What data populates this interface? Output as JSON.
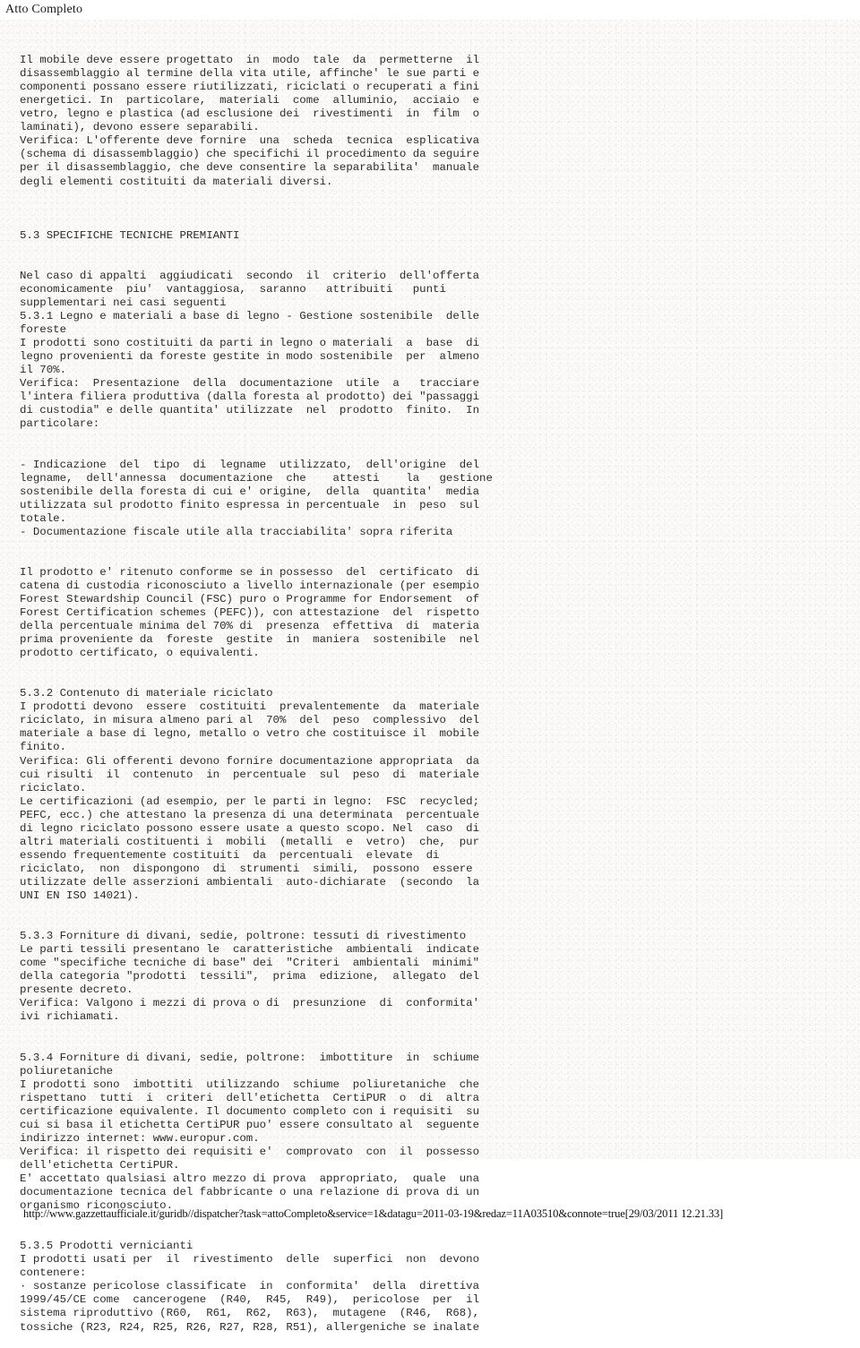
{
  "page": {
    "header_title": "Atto Completo",
    "background_color": "#fbfaf8",
    "text_color": "#2b2b2b"
  },
  "document": {
    "blocks": [
      {
        "id": "intro-disassemblaggio",
        "text": "Il mobile deve essere progettato  in  modo  tale  da  permetterne  il\ndisassemblaggio al termine della vita utile, affinche' le sue parti e\ncomponenti possano essere riutilizzati, riciclati o recuperati a fini\nenergetici. In  particolare,  materiali  come  alluminio,  acciaio  e\nvetro, legno e plastica (ad esclusione dei  rivestimenti  in  film  o\nlaminati), devono essere separabili.\nVerifica: L'offerente deve fornire  una  scheda  tecnica  esplicativa\n(schema di disassemblaggio) che specifichi il procedimento da seguire\nper il disassemblaggio, che deve consentire la separabilita'  manuale\ndegli elementi costituiti da materiali diversi."
      },
      {
        "id": "heading-5-3",
        "text": "\n5.3 SPECIFICHE TECNICHE PREMIANTI\n"
      },
      {
        "id": "premianti-intro",
        "text": "Nel caso di appalti  aggiudicati  secondo  il  criterio  dell'offerta\neconomicamente  piu'  vantaggiosa,  saranno   attribuiti   punti\nsupplementari nei casi seguenti\n5.3.1 Legno e materiali a base di legno - Gestione sostenibile  delle\nforeste\nI prodotti sono costituiti da parti in legno o materiali  a  base  di\nlegno provenienti da foreste gestite in modo sostenibile  per  almeno\nil 70%.\nVerifica:  Presentazione  della  documentazione  utile  a   tracciare\nl'intera filiera produttiva (dalla foresta al prodotto) dei \"passaggi\ndi custodia\" e delle quantita' utilizzate  nel  prodotto  finito.  In\nparticolare:\n"
      },
      {
        "id": "indicazioni-legname",
        "text": "- Indicazione  del  tipo  di  legname  utilizzato,  dell'origine  del\nlegname,  dell'annessa  documentazione  che    attesti    la   gestione\nsostenibile della foresta di cui e' origine,  della  quantita'  media\nutilizzata sul prodotto finito espressa in percentuale  in  peso  sul\ntotale.\n- Documentazione fiscale utile alla tracciabilita' sopra riferita\n"
      },
      {
        "id": "certificato-catena-custodia",
        "text": "Il prodotto e' ritenuto conforme se in possesso  del  certificato  di\ncatena di custodia riconosciuto a livello internazionale (per esempio\nForest Stewardship Council (FSC) puro o Programme for Endorsement  of\nForest Certification schemes (PEFC)), con attestazione  del  rispetto\ndella percentuale minima del 70% di  presenza  effettiva  di  materia\nprima proveniente da  foreste  gestite  in  maniera  sostenibile  nel\nprodotto certificato, o equivalenti.\n"
      },
      {
        "id": "sezione-5-3-2",
        "text": "5.3.2 Contenuto di materiale riciclato\nI prodotti devono  essere  costituiti  prevalentemente  da  materiale\nriciclato, in misura almeno pari al  70%  del  peso  complessivo  del\nmateriale a base di legno, metallo o vetro che costituisce il  mobile\nfinito.\nVerifica: Gli offerenti devono fornire documentazione appropriata  da\ncui risulti  il  contenuto  in  percentuale  sul  peso  di  materiale\nriciclato.\nLe certificazioni (ad esempio, per le parti in legno:  FSC  recycled;\nPEFC, ecc.) che attestano la presenza di una determinata  percentuale\ndi legno riciclato possono essere usate a questo scopo. Nel  caso  di\naltri materiali costituenti i  mobili  (metalli  e  vetro)  che,  pur\nessendo frequentemente costituiti  da  percentuali  elevate  di\nriciclato,  non  dispongono  di  strumenti  simili,  possono  essere\nutilizzate delle asserzioni ambientali  auto-dichiarate  (secondo  la\nUNI EN ISO 14021).\n"
      },
      {
        "id": "sezione-5-3-3",
        "text": "5.3.3 Forniture di divani, sedie, poltrone: tessuti di rivestimento\nLe parti tessili presentano le  caratteristiche  ambientali  indicate\ncome \"specifiche tecniche di base\" dei  \"Criteri  ambientali  minimi\"\ndella categoria \"prodotti  tessili\",  prima  edizione,  allegato  del\npresente decreto.\nVerifica: Valgono i mezzi di prova o di  presunzione  di  conformita'\nivi richiamati.\n"
      },
      {
        "id": "sezione-5-3-4",
        "text": "5.3.4 Forniture di divani, sedie, poltrone:  imbottiture  in  schiume\npoliuretaniche\nI prodotti sono  imbottiti  utilizzando  schiume  poliuretaniche  che\nrispettano  tutti  i  criteri  dell'etichetta  CertiPUR  o  di  altra\ncertificazione equivalente. Il documento completo con i requisiti  su\ncui si basa il etichetta CertiPUR puo' essere consultato al  seguente\nindirizzo internet: www.europur.com.\nVerifica: il rispetto dei requisiti e'  comprovato  con  il  possesso\ndell'etichetta CertiPUR.\nE' accettato qualsiasi altro mezzo di prova  appropriato,  quale  una\ndocumentazione tecnica del fabbricante o una relazione di prova di un\norganismo riconosciuto.\n"
      },
      {
        "id": "sezione-5-3-5",
        "text": "5.3.5 Prodotti vernicianti\nI prodotti usati per  il  rivestimento  delle  superfici  non  devono\ncontenere:\n· sostanze pericolose classificate  in  conformita'  della  direttiva\n1999/45/CE come  cancerogene  (R40,  R45,  R49),  pericolose  per  il\nsistema riproduttivo (R60,  R61,  R62,  R63),  mutagene  (R46,  R68),\ntossiche (R23, R24, R25, R26, R27, R28, R51), allergeniche se inalate"
      }
    ]
  },
  "footer": {
    "url": "http://www.gazzettaufficiale.it/guridb//dispatcher?task=attoCompleto&service=1&datagu=2011-03-19&redaz=11A03510&connote=true[29/03/2011 12.21.33]"
  }
}
